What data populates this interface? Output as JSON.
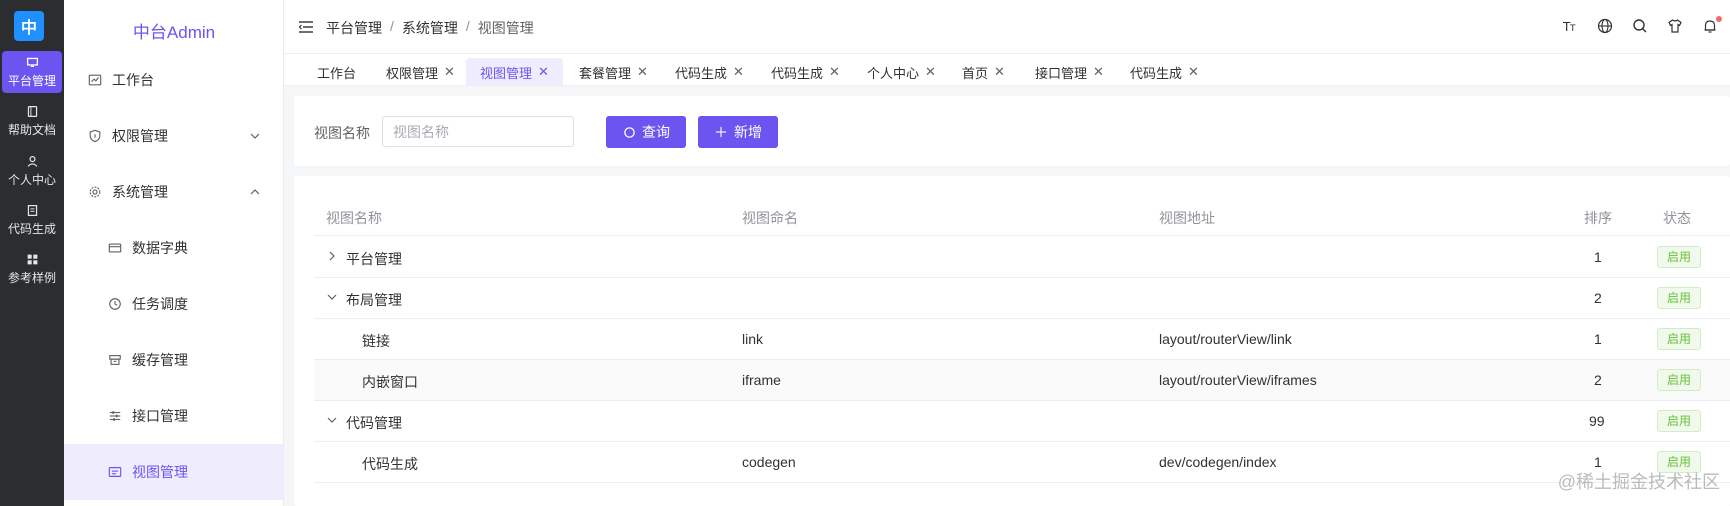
{
  "rail": {
    "logo_text": "中",
    "items": [
      {
        "label": "平台管理",
        "icon": "monitor-icon",
        "active": true
      },
      {
        "label": "帮助文档",
        "icon": "book-icon",
        "active": false
      },
      {
        "label": "个人中心",
        "icon": "user-icon",
        "active": false
      },
      {
        "label": "代码生成",
        "icon": "document-icon",
        "active": false
      },
      {
        "label": "参考样例",
        "icon": "grid-icon",
        "active": false
      }
    ]
  },
  "sidebar": {
    "title": "中台Admin",
    "items": [
      {
        "label": "工作台",
        "icon": "chart-icon",
        "level": 1
      },
      {
        "label": "权限管理",
        "icon": "shield-icon",
        "level": 1,
        "arrow": "down"
      },
      {
        "label": "系统管理",
        "icon": "gear-icon",
        "level": 1,
        "arrow": "up"
      },
      {
        "label": "数据字典",
        "icon": "card-icon",
        "level": 2
      },
      {
        "label": "任务调度",
        "icon": "clock-icon",
        "level": 2
      },
      {
        "label": "缓存管理",
        "icon": "box-icon",
        "level": 2
      },
      {
        "label": "接口管理",
        "icon": "sliders-icon",
        "level": 2
      },
      {
        "label": "视图管理",
        "icon": "window-icon",
        "level": 2,
        "active": true
      }
    ]
  },
  "header": {
    "breadcrumb": [
      "平台管理",
      "系统管理",
      "视图管理"
    ],
    "icons": [
      "font-size-icon",
      "globe-icon",
      "search-icon",
      "shirt-icon",
      "bell-icon"
    ]
  },
  "tabs": [
    {
      "label": "工作台",
      "closable": false
    },
    {
      "label": "权限管理",
      "closable": true
    },
    {
      "label": "视图管理",
      "closable": true,
      "active": true
    },
    {
      "label": "套餐管理",
      "closable": true
    },
    {
      "label": "代码生成",
      "closable": true
    },
    {
      "label": "代码生成",
      "closable": true
    },
    {
      "label": "个人中心",
      "closable": true
    },
    {
      "label": "首页",
      "closable": true
    },
    {
      "label": "接口管理",
      "closable": true
    },
    {
      "label": "代码生成",
      "closable": true
    }
  ],
  "search": {
    "label": "视图名称",
    "placeholder": "视图名称",
    "value": "",
    "query_label": "查询",
    "add_label": "新增"
  },
  "table": {
    "columns": [
      "视图名称",
      "视图命名",
      "视图地址",
      "排序",
      "状态"
    ],
    "rows": [
      {
        "name": "平台管理",
        "code": "",
        "path": "",
        "sort": "1",
        "status": "启用",
        "level": 0,
        "expander": "right"
      },
      {
        "name": "布局管理",
        "code": "",
        "path": "",
        "sort": "2",
        "status": "启用",
        "level": 0,
        "expander": "down"
      },
      {
        "name": "链接",
        "code": "link",
        "path": "layout/routerView/link",
        "sort": "1",
        "status": "启用",
        "level": 1
      },
      {
        "name": "内嵌窗口",
        "code": "iframe",
        "path": "layout/routerView/iframes",
        "sort": "2",
        "status": "启用",
        "level": 1
      },
      {
        "name": "代码管理",
        "code": "",
        "path": "",
        "sort": "99",
        "status": "启用",
        "level": 0,
        "expander": "down"
      },
      {
        "name": "代码生成",
        "code": "codegen",
        "path": "dev/codegen/index",
        "sort": "1",
        "status": "启用",
        "level": 1
      }
    ]
  },
  "watermark": "@稀土掘金技术社区",
  "colors": {
    "accent": "#6b54f0",
    "success": "#67c23a",
    "rail_bg": "#2b2d30"
  }
}
